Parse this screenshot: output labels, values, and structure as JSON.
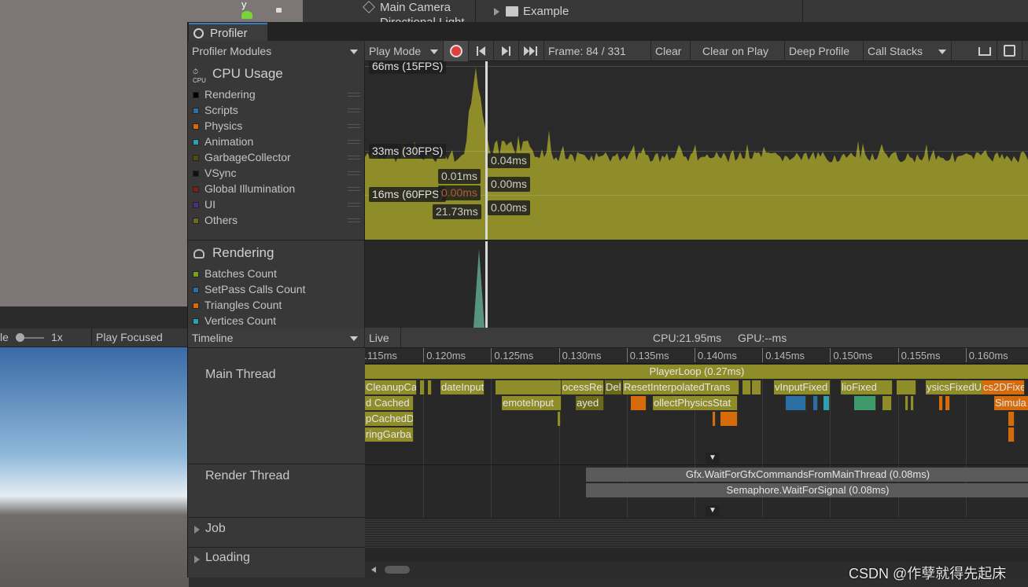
{
  "background": {
    "hierarchy": {
      "main_camera": "Main Camera",
      "directional_light": "Directional Light",
      "example": "Example"
    },
    "scene_gizmo_axis": "y",
    "game_toolbar": {
      "scale_label": "le",
      "scale_value": "1x",
      "play_focused": "Play Focused"
    }
  },
  "profiler": {
    "tab_title": "Profiler",
    "modules_dropdown": "Profiler Modules",
    "toolbar": {
      "play_mode": "Play Mode",
      "frame": "Frame: 84 / 331",
      "clear": "Clear",
      "clear_on_play": "Clear on Play",
      "deep_profile": "Deep Profile",
      "call_stacks": "Call Stacks"
    },
    "cpu_module": {
      "title": "CPU Usage",
      "icon_text": "CPU",
      "legend": [
        {
          "label": "Rendering",
          "color": "#000000"
        },
        {
          "label": "Scripts",
          "color": "#2b6ea3"
        },
        {
          "label": "Physics",
          "color": "#d66b0b"
        },
        {
          "label": "Animation",
          "color": "#2f9fb2"
        },
        {
          "label": "GarbageCollector",
          "color": "#4f4d14"
        },
        {
          "label": "VSync",
          "color": "#111111"
        },
        {
          "label": "Global Illumination",
          "color": "#7a1f14"
        },
        {
          "label": "UI",
          "color": "#4b2f85"
        },
        {
          "label": "Others",
          "color": "#6b6a1c"
        }
      ],
      "fps_labels": {
        "fps15": "66ms (15FPS)",
        "fps30": "33ms (30FPS)",
        "fps60": "16ms (60FPS)"
      },
      "selection_labels": {
        "a": "0.01ms",
        "b": "0.00ms",
        "c": "21.73ms",
        "d": "0.04ms",
        "e": "0.00ms",
        "f": "0.00ms"
      },
      "area_color": "#8f8c2a"
    },
    "rendering_module": {
      "title": "Rendering",
      "legend": [
        {
          "label": "Batches Count",
          "color": "#7ea11c"
        },
        {
          "label": "SetPass Calls Count",
          "color": "#2b6ea3"
        },
        {
          "label": "Triangles Count",
          "color": "#d66b0b"
        },
        {
          "label": "Vertices Count",
          "color": "#2f9fb2"
        }
      ]
    },
    "details": {
      "view_dropdown": "Timeline",
      "live": "Live",
      "cpu": "CPU:21.95ms",
      "gpu": "GPU:--ms",
      "ruler": [
        "0.115ms",
        "0.120ms",
        "0.125ms",
        "0.130ms",
        "0.135ms",
        "0.140ms",
        "0.145ms",
        "0.150ms",
        "0.155ms",
        "0.160ms"
      ],
      "threads": {
        "main": "Main Thread",
        "render": "Render Thread",
        "job": "Job",
        "loading": "Loading"
      },
      "main_bars": {
        "player_loop": "PlayerLoop (0.27ms)",
        "r1": [
          "CleanupCa",
          "dateInputMa",
          "ocessRemote",
          "Delayed",
          "ResetInterpolatedTrans",
          "vInputFixed",
          "lioFixed",
          "ysicsFixedU",
          "cs2DFixe"
        ],
        "r2": [
          "d Cached",
          "emoteInput",
          "ayed",
          "ollectPhysicsStat",
          "Simula"
        ],
        "r3": [
          "pCachedD"
        ],
        "r4": [
          "ringGarba"
        ]
      },
      "render_bars": {
        "gfx": "Gfx.WaitForGfxCommandsFromMainThread (0.08ms)",
        "semaphore": "Semaphore.WaitForSignal (0.08ms)"
      }
    }
  },
  "watermark": "CSDN @作孽就得先起床"
}
